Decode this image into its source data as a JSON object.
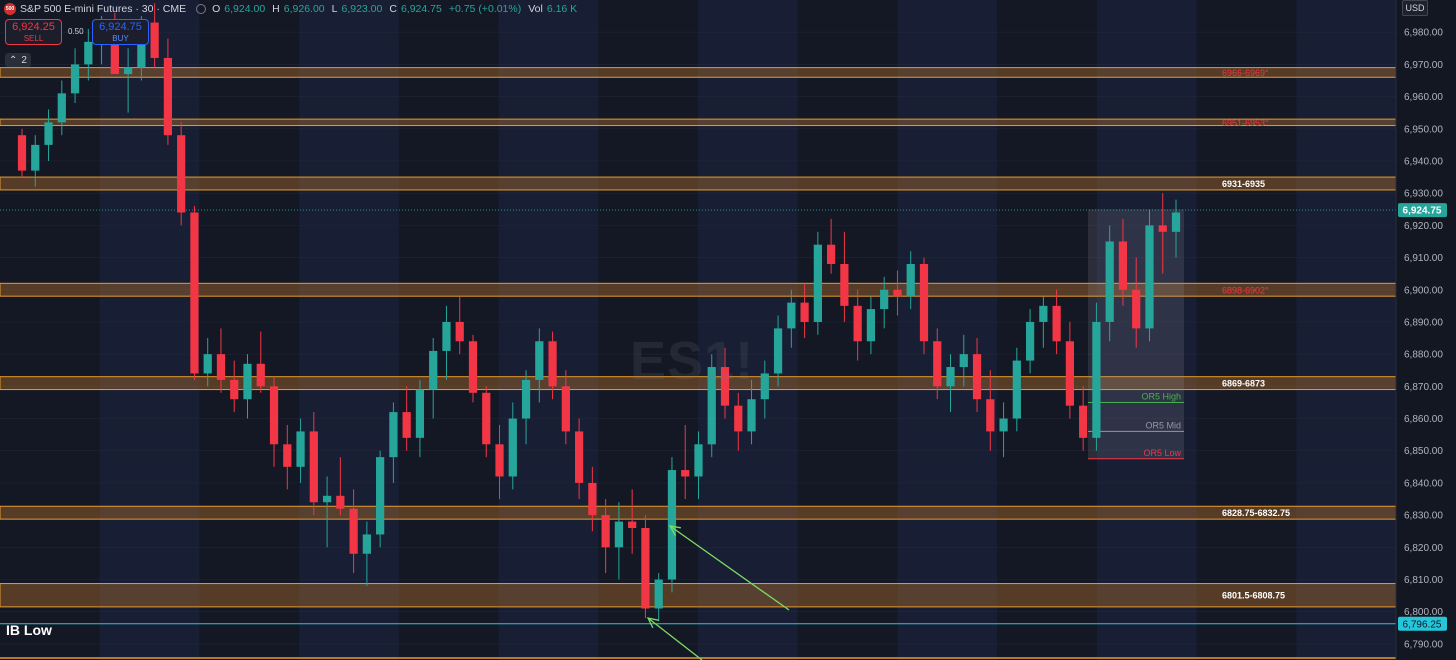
{
  "header": {
    "symbol_title": "S&P 500 E-mini Futures · 30 · CME",
    "logo_text": "500",
    "ohlc": [
      {
        "label": "O",
        "value": "6,924.00"
      },
      {
        "label": "H",
        "value": "6,926.00"
      },
      {
        "label": "L",
        "value": "6,923.00"
      },
      {
        "label": "C",
        "value": "6,924.75"
      }
    ],
    "change": "+0.75 (+0.01%)",
    "volume_label": "Vol",
    "volume_value": "6.16 K"
  },
  "trade": {
    "sell_price": "6,924.25",
    "sell_label": "SELL",
    "spread": "0.50",
    "buy_price": "6,924.75",
    "buy_label": "BUY"
  },
  "indicators_toggle": {
    "count": "2"
  },
  "currency": "USD",
  "watermark": "ES1!",
  "ib_low_label": "IB Low",
  "colors": {
    "up": "#26a69a",
    "down": "#f23645",
    "zone_fill": "#b8742a",
    "zone_border": "#e69b2e",
    "background": "#141824",
    "night_band": "#1b2541"
  },
  "chart_data": {
    "type": "candlestick",
    "interval": "30",
    "ylim": [
      6785,
      6990
    ],
    "y_ticks": [
      "6,980.00",
      "6,970.00",
      "6,960.00",
      "6,950.00",
      "6,940.00",
      "6,930.00",
      "6,920.00",
      "6,910.00",
      "6,900.00",
      "6,890.00",
      "6,880.00",
      "6,870.00",
      "6,860.00",
      "6,850.00",
      "6,840.00",
      "6,830.00",
      "6,820.00",
      "6,810.00",
      "6,800.00",
      "6,790.00"
    ],
    "last_price": {
      "label": "6,924.75",
      "value": 6924.75
    },
    "ib_low_price": {
      "label": "6,796.25",
      "value": 6796.25
    },
    "zones": [
      {
        "label": "6966-6969°",
        "low": 6966,
        "high": 6969,
        "label_color": "#f23645"
      },
      {
        "label": "6951-6953°",
        "low": 6951,
        "high": 6953,
        "label_color": "#f23645"
      },
      {
        "label": "6931-6935",
        "low": 6931,
        "high": 6935,
        "label_color": "#ffffff"
      },
      {
        "label": "6898-6902°",
        "low": 6898,
        "high": 6902,
        "label_color": "#f23645"
      },
      {
        "label": "6869-6873",
        "low": 6869,
        "high": 6873,
        "label_color": "#ffffff"
      },
      {
        "label": "6828.75-6832.75",
        "low": 6828.75,
        "high": 6832.75,
        "label_color": "#ffffff"
      },
      {
        "label": "6801.5-6808.75",
        "low": 6801.5,
        "high": 6808.75,
        "label_color": "#ffffff"
      }
    ],
    "opening_range": {
      "high": {
        "label": "OR5 High",
        "value": 6865
      },
      "mid": {
        "label": "OR5 Mid",
        "value": 6856
      },
      "low": {
        "label": "OR5 Low",
        "value": 6847.5
      },
      "box_top": 6925,
      "box_bottom": 6847.5
    },
    "candles": [
      [
        6948,
        6950,
        6935,
        6937
      ],
      [
        6937,
        6948,
        6932,
        6945
      ],
      [
        6945,
        6956,
        6940,
        6952
      ],
      [
        6952,
        6965,
        6948,
        6961
      ],
      [
        6961,
        6975,
        6958,
        6970
      ],
      [
        6970,
        6981,
        6965,
        6977
      ],
      [
        6977,
        6985,
        6970,
        6980
      ],
      [
        6980,
        6986,
        6972,
        6967
      ],
      [
        6967,
        6975,
        6955,
        6969
      ],
      [
        6969,
        6985,
        6965,
        6983
      ],
      [
        6983,
        6989,
        6969,
        6972
      ],
      [
        6972,
        6978,
        6945,
        6948
      ],
      [
        6948,
        6952,
        6920,
        6924
      ],
      [
        6924,
        6926,
        6872,
        6874
      ],
      [
        6874,
        6885,
        6870,
        6880
      ],
      [
        6880,
        6888,
        6868,
        6872
      ],
      [
        6872,
        6878,
        6862,
        6866
      ],
      [
        6866,
        6880,
        6860,
        6877
      ],
      [
        6877,
        6887,
        6868,
        6870
      ],
      [
        6870,
        6873,
        6845,
        6852
      ],
      [
        6852,
        6858,
        6838,
        6845
      ],
      [
        6845,
        6860,
        6840,
        6856
      ],
      [
        6856,
        6862,
        6830,
        6834
      ],
      [
        6834,
        6842,
        6820,
        6836
      ],
      [
        6836,
        6848,
        6830,
        6832
      ],
      [
        6832,
        6838,
        6812,
        6818
      ],
      [
        6818,
        6828,
        6808,
        6824
      ],
      [
        6824,
        6850,
        6820,
        6848
      ],
      [
        6848,
        6865,
        6840,
        6862
      ],
      [
        6862,
        6870,
        6850,
        6854
      ],
      [
        6854,
        6872,
        6848,
        6869
      ],
      [
        6869,
        6885,
        6860,
        6881
      ],
      [
        6881,
        6895,
        6872,
        6890
      ],
      [
        6890,
        6898,
        6880,
        6884
      ],
      [
        6884,
        6886,
        6865,
        6868
      ],
      [
        6868,
        6870,
        6848,
        6852
      ],
      [
        6852,
        6858,
        6835,
        6842
      ],
      [
        6842,
        6865,
        6838,
        6860
      ],
      [
        6860,
        6875,
        6852,
        6872
      ],
      [
        6872,
        6888,
        6865,
        6884
      ],
      [
        6884,
        6887,
        6866,
        6870
      ],
      [
        6870,
        6875,
        6852,
        6856
      ],
      [
        6856,
        6860,
        6835,
        6840
      ],
      [
        6840,
        6845,
        6825,
        6830
      ],
      [
        6830,
        6835,
        6812,
        6820
      ],
      [
        6820,
        6834,
        6810,
        6828
      ],
      [
        6828,
        6838,
        6818,
        6826
      ],
      [
        6826,
        6830,
        6798,
        6801
      ],
      [
        6801,
        6812,
        6797,
        6810
      ],
      [
        6810,
        6848,
        6806,
        6844
      ],
      [
        6844,
        6858,
        6835,
        6842
      ],
      [
        6842,
        6856,
        6835,
        6852
      ],
      [
        6852,
        6880,
        6848,
        6876
      ],
      [
        6876,
        6882,
        6860,
        6864
      ],
      [
        6864,
        6868,
        6850,
        6856
      ],
      [
        6856,
        6872,
        6852,
        6866
      ],
      [
        6866,
        6878,
        6860,
        6874
      ],
      [
        6874,
        6892,
        6870,
        6888
      ],
      [
        6888,
        6900,
        6882,
        6896
      ],
      [
        6896,
        6902,
        6885,
        6890
      ],
      [
        6890,
        6918,
        6886,
        6914
      ],
      [
        6914,
        6922,
        6905,
        6908
      ],
      [
        6908,
        6918,
        6890,
        6895
      ],
      [
        6895,
        6900,
        6878,
        6884
      ],
      [
        6884,
        6898,
        6880,
        6894
      ],
      [
        6894,
        6904,
        6888,
        6900
      ],
      [
        6900,
        6906,
        6892,
        6898
      ],
      [
        6898,
        6912,
        6894,
        6908
      ],
      [
        6908,
        6910,
        6880,
        6884
      ],
      [
        6884,
        6888,
        6866,
        6870
      ],
      [
        6870,
        6880,
        6862,
        6876
      ],
      [
        6876,
        6886,
        6870,
        6880
      ],
      [
        6880,
        6885,
        6862,
        6866
      ],
      [
        6866,
        6875,
        6850,
        6856
      ],
      [
        6856,
        6865,
        6848,
        6860
      ],
      [
        6860,
        6882,
        6856,
        6878
      ],
      [
        6878,
        6894,
        6874,
        6890
      ],
      [
        6890,
        6898,
        6882,
        6895
      ],
      [
        6895,
        6900,
        6880,
        6884
      ],
      [
        6884,
        6890,
        6860,
        6864
      ],
      [
        6864,
        6870,
        6850,
        6854
      ],
      [
        6854,
        6896,
        6850,
        6890
      ],
      [
        6890,
        6920,
        6884,
        6915
      ],
      [
        6915,
        6922,
        6895,
        6900
      ],
      [
        6900,
        6910,
        6882,
        6888
      ],
      [
        6888,
        6925,
        6884,
        6920
      ],
      [
        6920,
        6930,
        6905,
        6918
      ],
      [
        6918,
        6928,
        6910,
        6924
      ]
    ]
  }
}
